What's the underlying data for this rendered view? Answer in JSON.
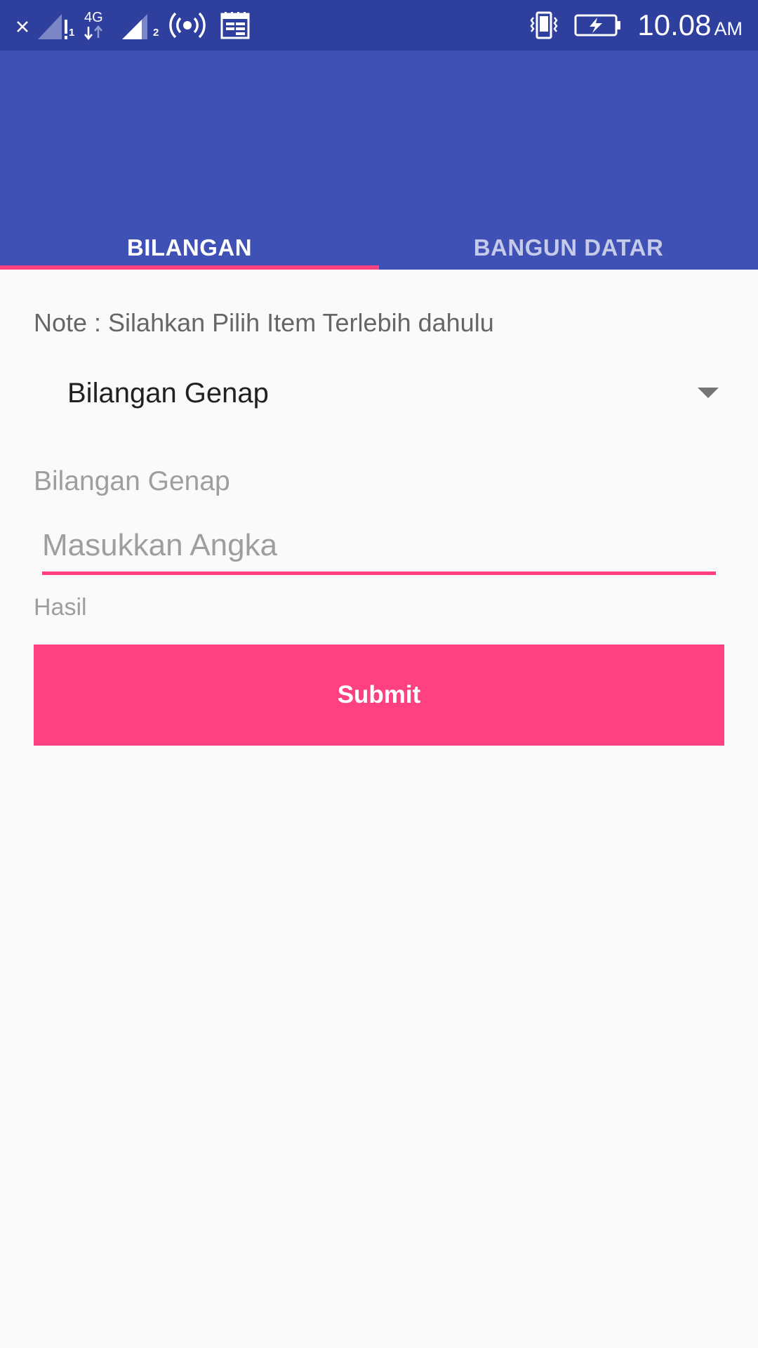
{
  "status_bar": {
    "left_icons": [
      "close-icon",
      "signal-sim1-icon",
      "network-4g-icon",
      "signal-sim2-icon",
      "hotspot-icon",
      "calendar-icon"
    ],
    "sim1_marker": "1",
    "sim2_marker": "2",
    "network_type": "4G",
    "right_icons": [
      "vibrate-icon",
      "battery-charging-icon"
    ],
    "time": "10.08",
    "ampm": "AM"
  },
  "tabs": [
    {
      "label": "BILANGAN",
      "active": true
    },
    {
      "label": "BANGUN DATAR",
      "active": false
    }
  ],
  "form": {
    "note": "Note : Silahkan Pilih Item Terlebih dahulu",
    "spinner_value": "Bilangan Genap",
    "field_label": "Bilangan Genap",
    "input_placeholder": "Masukkan Angka",
    "input_value": "",
    "result_label": "Hasil",
    "submit_label": "Submit"
  },
  "colors": {
    "status_bar": "#2f3f9e",
    "primary": "#3f51b5",
    "accent": "#ff4081",
    "background": "#fafafa"
  }
}
